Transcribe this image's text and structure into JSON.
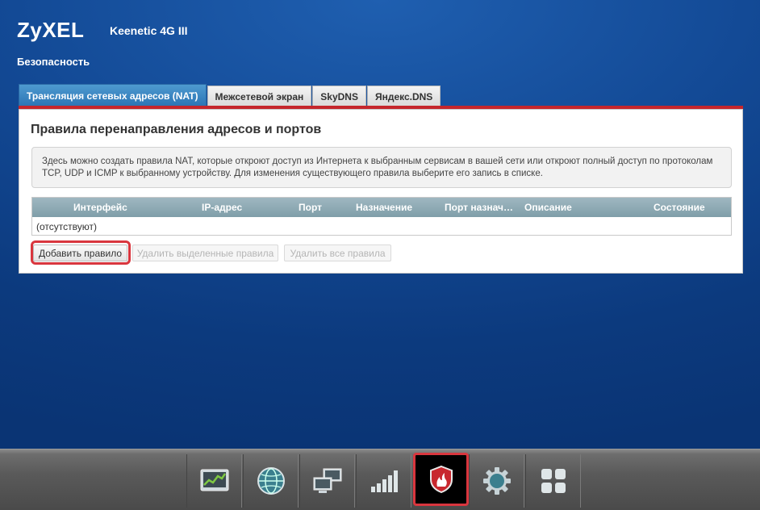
{
  "header": {
    "logo": "ZyXEL",
    "model": "Keenetic 4G III",
    "section": "Безопасность"
  },
  "tabs": [
    {
      "label": "Трансляция сетевых адресов (NAT)",
      "active": true
    },
    {
      "label": "Межсетевой экран",
      "active": false
    },
    {
      "label": "SkyDNS",
      "active": false
    },
    {
      "label": "Яндекс.DNS",
      "active": false
    }
  ],
  "panel": {
    "title": "Правила перенаправления адресов и портов",
    "info": "Здесь можно создать правила NAT, которые откроют доступ из Интернета к выбранным сервисам в вашей сети или откроют полный доступ по протоколам TCP, UDP и ICMP к выбранному устройству. Для изменения существующего правила выберите его запись в списке."
  },
  "table": {
    "columns": [
      "Интерфейс",
      "IP-адрес",
      "Порт",
      "Назначение",
      "Порт назнач…",
      "Описание",
      "Состояние"
    ],
    "empty_text": "(отсутствуют)"
  },
  "buttons": {
    "add": "Добавить правило",
    "delete_selected": "Удалить выделенные правила",
    "delete_all": "Удалить все правила"
  },
  "taskbar": {
    "items": [
      "monitor-icon",
      "globe-icon",
      "network-icon",
      "signal-icon",
      "shield-icon",
      "gear-icon",
      "apps-icon"
    ],
    "active_index": 4
  },
  "colors": {
    "accent_red": "#d9363e",
    "tab_active": "#2b74b4",
    "background": "#134a96"
  }
}
